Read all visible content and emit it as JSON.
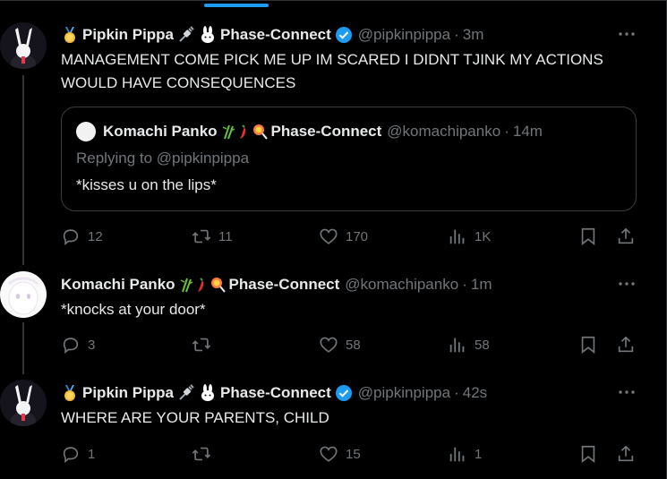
{
  "colors": {
    "accent": "#1d9bf0",
    "text": "#e7e9ea",
    "muted": "#71767b",
    "border": "#2f3336"
  },
  "tweets": [
    {
      "author": "Pipkin Pippa",
      "affiliation": "Phase-Connect",
      "handle": "@pipkinpippa",
      "sep": "·",
      "time": "3m",
      "text": "MANAGEMENT COME PICK ME UP IM SCARED I DIDNT TJINK MY ACTIONS WOULD HAVE CONSEQUENCES",
      "quote": {
        "author": "Komachi Panko",
        "affiliation": "Phase-Connect",
        "handle": "@komachipanko",
        "sep": "·",
        "time": "14m",
        "replying": "Replying to @pipkinpippa",
        "text": "*kisses u on the lips*"
      },
      "stats": {
        "replies": "12",
        "reposts": "11",
        "likes": "170",
        "views": "1K"
      }
    },
    {
      "author": "Komachi Panko",
      "affiliation": "Phase-Connect",
      "handle": "@komachipanko",
      "sep": "·",
      "time": "1m",
      "text": "*knocks at your door*",
      "stats": {
        "replies": "3",
        "reposts": "",
        "likes": "58",
        "views": "58"
      }
    },
    {
      "author": "Pipkin Pippa",
      "affiliation": "Phase-Connect",
      "handle": "@pipkinpippa",
      "sep": "·",
      "time": "42s",
      "text": "WHERE ARE YOUR PARENTS, CHILD",
      "stats": {
        "replies": "1",
        "reposts": "",
        "likes": "15",
        "views": "1"
      }
    }
  ],
  "icons": [
    "reply-icon",
    "repost-icon",
    "like-icon",
    "views-icon",
    "bookmark-icon",
    "share-icon",
    "more-icon",
    "verified-icon",
    "medal-icon",
    "plug-icon",
    "rabbit-icon",
    "bamboo-icon",
    "chili-icon",
    "lollipop-icon"
  ]
}
